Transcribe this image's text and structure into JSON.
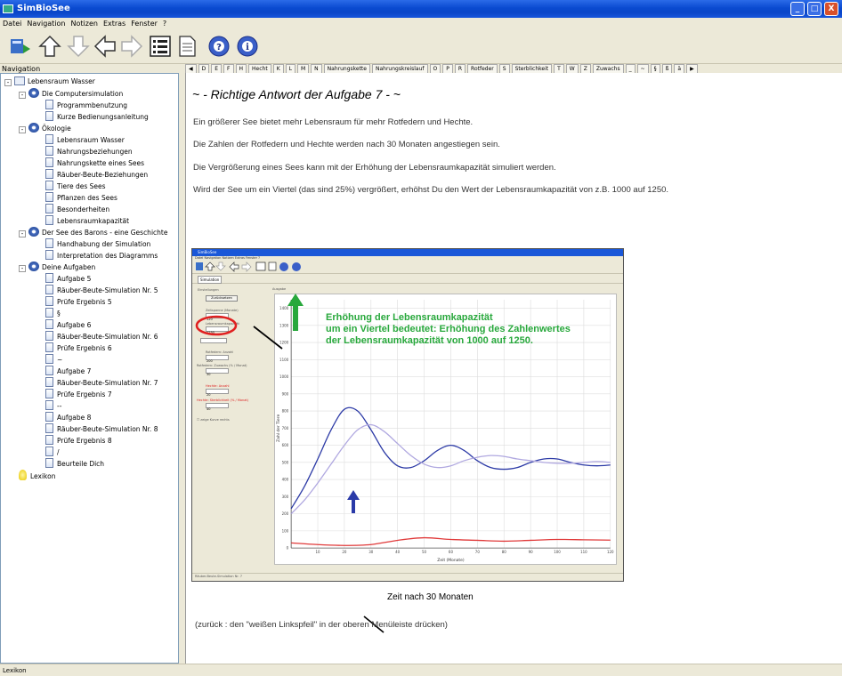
{
  "window": {
    "title": "SimBioSee",
    "min_glyph": "_",
    "max_glyph": "□",
    "close_glyph": "X"
  },
  "menu": [
    "Datei",
    "Navigation",
    "Notizen",
    "Extras",
    "Fenster",
    "?"
  ],
  "toolbar": {
    "icons": [
      "sync-icon",
      "up-arrow-icon",
      "down-arrow-icon",
      "back-arrow-icon",
      "forward-arrow-icon",
      "contents-icon",
      "page-icon",
      "help-icon",
      "info-icon"
    ]
  },
  "navigation": {
    "label": "Navigation",
    "tree": [
      {
        "label": "Lebensraum Wasser",
        "level": 0,
        "icon": "folder",
        "expander": "-"
      },
      {
        "label": "Die Computersimulation",
        "level": 1,
        "icon": "help",
        "expander": "-"
      },
      {
        "label": "Programmbenutzung",
        "level": 2,
        "icon": "page"
      },
      {
        "label": "Kurze Bedienungsanleitung",
        "level": 2,
        "icon": "page"
      },
      {
        "label": "Ökologie",
        "level": 1,
        "icon": "help",
        "expander": "-"
      },
      {
        "label": "Lebensraum Wasser",
        "level": 2,
        "icon": "page"
      },
      {
        "label": "Nahrungsbeziehungen",
        "level": 2,
        "icon": "page"
      },
      {
        "label": "Nahrungskette eines Sees",
        "level": 2,
        "icon": "page"
      },
      {
        "label": "Räuber-Beute-Beziehungen",
        "level": 2,
        "icon": "page"
      },
      {
        "label": "Tiere des Sees",
        "level": 2,
        "icon": "page"
      },
      {
        "label": "Pflanzen des Sees",
        "level": 2,
        "icon": "page"
      },
      {
        "label": "Besonderheiten",
        "level": 2,
        "icon": "page"
      },
      {
        "label": "Lebensraumkapazität",
        "level": 2,
        "icon": "page"
      },
      {
        "label": "Der See des Barons - eine Geschichte",
        "level": 1,
        "icon": "help",
        "expander": "-"
      },
      {
        "label": "Handhabung der Simulation",
        "level": 2,
        "icon": "page"
      },
      {
        "label": "Interpretation des Diagramms",
        "level": 2,
        "icon": "page"
      },
      {
        "label": "Deine Aufgaben",
        "level": 1,
        "icon": "help",
        "expander": "-"
      },
      {
        "label": "Aufgabe 5",
        "level": 2,
        "icon": "page"
      },
      {
        "label": "Räuber-Beute-Simulation Nr. 5",
        "level": 2,
        "icon": "page"
      },
      {
        "label": "Prüfe Ergebnis 5",
        "level": 2,
        "icon": "page"
      },
      {
        "label": "§",
        "level": 2,
        "icon": "page"
      },
      {
        "label": "Aufgabe 6",
        "level": 2,
        "icon": "page"
      },
      {
        "label": "Räuber-Beute-Simulation Nr. 6",
        "level": 2,
        "icon": "page"
      },
      {
        "label": "Prüfe Ergebnis 6",
        "level": 2,
        "icon": "page"
      },
      {
        "label": "~",
        "level": 2,
        "icon": "page"
      },
      {
        "label": "Aufgabe 7",
        "level": 2,
        "icon": "page"
      },
      {
        "label": "Räuber-Beute-Simulation Nr. 7",
        "level": 2,
        "icon": "page"
      },
      {
        "label": "Prüfe Ergebnis 7",
        "level": 2,
        "icon": "page"
      },
      {
        "label": "--",
        "level": 2,
        "icon": "page"
      },
      {
        "label": "Aufgabe 8",
        "level": 2,
        "icon": "page"
      },
      {
        "label": "Räuber-Beute-Simulation Nr. 8",
        "level": 2,
        "icon": "page"
      },
      {
        "label": "Prüfe Ergebnis 8",
        "level": 2,
        "icon": "page"
      },
      {
        "label": "/",
        "level": 2,
        "icon": "page"
      },
      {
        "label": "Beurteile Dich",
        "level": 2,
        "icon": "page"
      },
      {
        "label": "Lexikon",
        "level": 1,
        "icon": "bulb"
      }
    ]
  },
  "index_tabs": [
    "◀",
    "D",
    "E",
    "F",
    "H",
    "Hecht",
    "K",
    "L",
    "M",
    "N",
    "Nahrungskette",
    "Nahrungskreislauf",
    "O",
    "P",
    "R",
    "Rotfeder",
    "S",
    "Sterblichkeit",
    "T",
    "W",
    "Z",
    "Zuwachs",
    "_",
    "~",
    "§",
    "ß",
    "ä",
    "▶"
  ],
  "content": {
    "heading": "~ - Richtige Antwort der Aufgabe 7 - ~",
    "paragraphs": [
      "Ein größerer See bietet mehr Lebensraum für mehr Rotfedern und Hechte.",
      "Die Zahlen der Rotfedern und Hechte werden nach 30 Monaten angestiegen sein.",
      "Die Vergrößerung eines Sees kann mit der Erhöhung der Lebensraumkapazität simuliert werden.",
      "Wird der See um ein Viertel (das sind 25%) vergrößert, erhöhst Du den Wert der Lebensraumkapazität von z.B. 1000 auf 1250."
    ],
    "annotation_lines": [
      "Erhöhung der Lebensraumkapazität",
      "um ein Viertel bedeutet: Erhöhung des Zahlenwertes",
      "der Lebensraumkapazität von 1000 auf 1250."
    ],
    "time_note": "Zeit nach 30 Monaten",
    "back_note": "(zurück : den \"weißen Linkspfeil\" in der oberen Menüleiste drücken)"
  },
  "embedded_screenshot": {
    "title": "SimBioSee",
    "menu": "Datei  Navigation  Notizen  Extras  Fenster  ?",
    "tab": "Simulation",
    "settings_label": "Einstellungen",
    "output_label": "Ausgabe",
    "start_button": "Zurücksetzen",
    "fields": [
      {
        "label": "Zeitspanne (Monate)",
        "value": "120",
        "color": "normal"
      },
      {
        "label": "Lebensraumkapazität",
        "value": "1250",
        "color": "normal"
      },
      {
        "label": "Rotfedern: Anzahl",
        "value": "200",
        "color": "normal"
      },
      {
        "label": "Rotfedern: Zuwachs (% / Monat)",
        "value": "30",
        "color": "normal"
      },
      {
        "label": "Hechte: Anzahl",
        "value": "20",
        "color": "red"
      },
      {
        "label": "Hechte: Sterblichkeit (% / Monat)",
        "value": "40",
        "color": "red"
      }
    ],
    "checkbox_label": "zeige Kurve rechts",
    "status": "Räuber-Beute-Simulation Nr. 7",
    "chart_ylabel": "Zahl der Tiere",
    "chart_xlabel": "Zeit (Monate)",
    "chart_yticks": [
      "1400",
      "1300",
      "1200",
      "1100",
      "1000",
      "900",
      "800",
      "700",
      "600",
      "500",
      "400",
      "300",
      "200",
      "100",
      "0"
    ],
    "chart_xticks": [
      "10",
      "20",
      "30",
      "40",
      "50",
      "60",
      "70",
      "80",
      "90",
      "100",
      "110",
      "120"
    ]
  },
  "chart_data": {
    "type": "line",
    "xlabel": "Zeit (Monate)",
    "ylabel": "Zahl der Tiere",
    "xlim": [
      0,
      120
    ],
    "ylim": [
      0,
      1450
    ],
    "grid": true,
    "series": [
      {
        "color": "#2c3aa6",
        "x": [
          0,
          5,
          10,
          15,
          20,
          25,
          30,
          35,
          40,
          45,
          50,
          55,
          60,
          65,
          70,
          75,
          80,
          85,
          90,
          95,
          100,
          105,
          110,
          115,
          120
        ],
        "y": [
          230,
          360,
          520,
          690,
          810,
          800,
          690,
          560,
          480,
          470,
          510,
          570,
          600,
          570,
          510,
          470,
          460,
          470,
          500,
          520,
          520,
          500,
          485,
          480,
          485
        ]
      },
      {
        "color": "#b0a8e0",
        "x": [
          0,
          5,
          10,
          15,
          20,
          25,
          30,
          35,
          40,
          45,
          50,
          55,
          60,
          65,
          70,
          75,
          80,
          85,
          90,
          95,
          100,
          105,
          110,
          115,
          120
        ],
        "y": [
          200,
          280,
          380,
          490,
          600,
          690,
          720,
          680,
          610,
          540,
          490,
          470,
          480,
          510,
          530,
          540,
          535,
          520,
          510,
          500,
          495,
          495,
          500,
          505,
          500
        ]
      },
      {
        "color": "#e03a3a",
        "x": [
          0,
          10,
          20,
          30,
          40,
          50,
          60,
          70,
          80,
          90,
          100,
          110,
          120
        ],
        "y": [
          30,
          20,
          15,
          20,
          45,
          60,
          50,
          45,
          40,
          45,
          50,
          48,
          46
        ]
      }
    ]
  },
  "status_bar": "Lexikon"
}
